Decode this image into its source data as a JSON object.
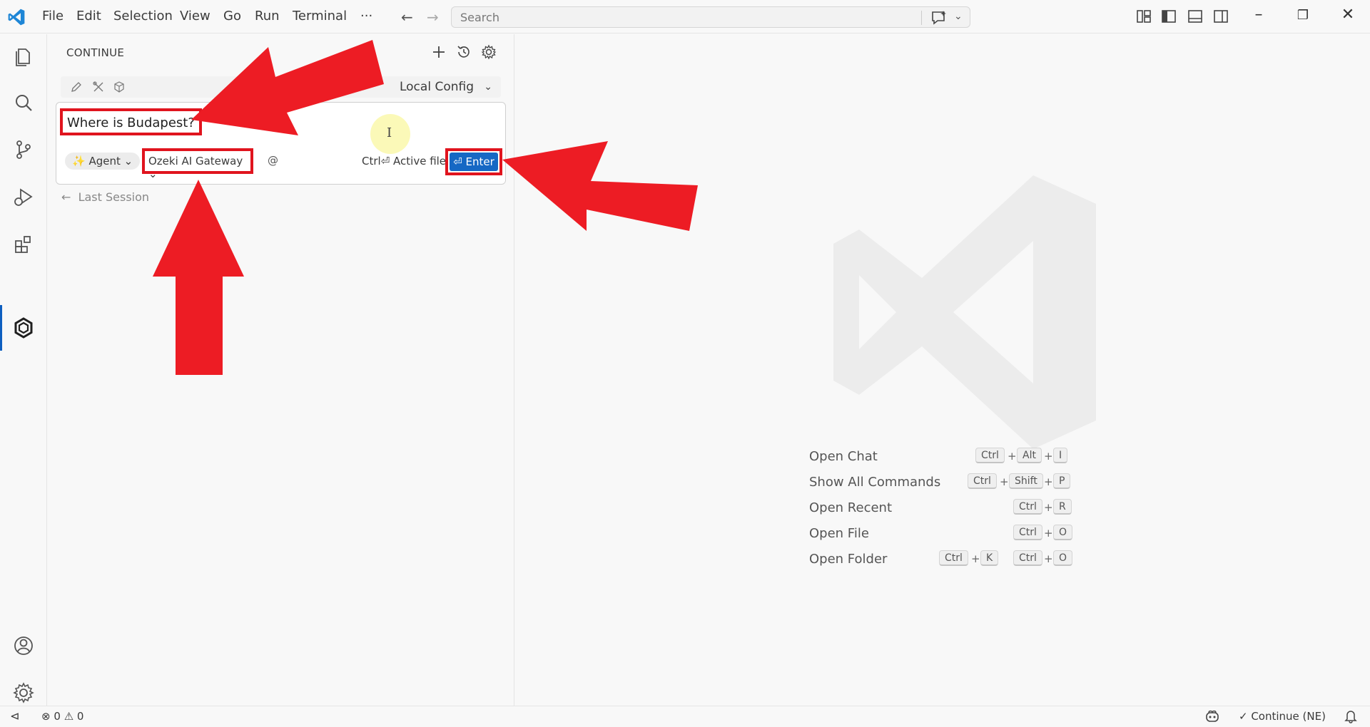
{
  "menu": {
    "items": [
      "File",
      "Edit",
      "Selection",
      "View",
      "Go",
      "Run",
      "Terminal",
      "···"
    ]
  },
  "search": {
    "placeholder": "Search"
  },
  "sidebar": {
    "title": "CONTINUE",
    "config_label": "Local Config",
    "prompt_value": "Where is Budapest?",
    "mode_label": "Agent",
    "model_label": "Ozeki AI Gateway",
    "at_label": "@",
    "active_file_hint": "Ctrl⏎ Active file",
    "enter_label": "⏎ Enter",
    "last_session_label": "Last Session"
  },
  "welcome": {
    "shortcuts": [
      {
        "label": "Open Chat",
        "keys": [
          "Ctrl",
          "+",
          "Alt",
          "+",
          "I"
        ]
      },
      {
        "label": "Show All Commands",
        "keys": [
          "Ctrl",
          "+",
          "Shift",
          "+",
          "P"
        ]
      },
      {
        "label": "Open Recent",
        "keys": [
          "Ctrl",
          "+",
          "R"
        ]
      },
      {
        "label": "Open File",
        "keys": [
          "Ctrl",
          "+",
          "O"
        ]
      },
      {
        "label": "Open Folder",
        "keys": [
          "Ctrl",
          "+",
          "K",
          "Ctrl",
          "+",
          "O"
        ]
      }
    ]
  },
  "status": {
    "errors": "0",
    "warnings": "0",
    "continue_label": "✓ Continue (NE)"
  },
  "colors": {
    "accent": "#1668c4",
    "annotation": "#e0141e"
  }
}
